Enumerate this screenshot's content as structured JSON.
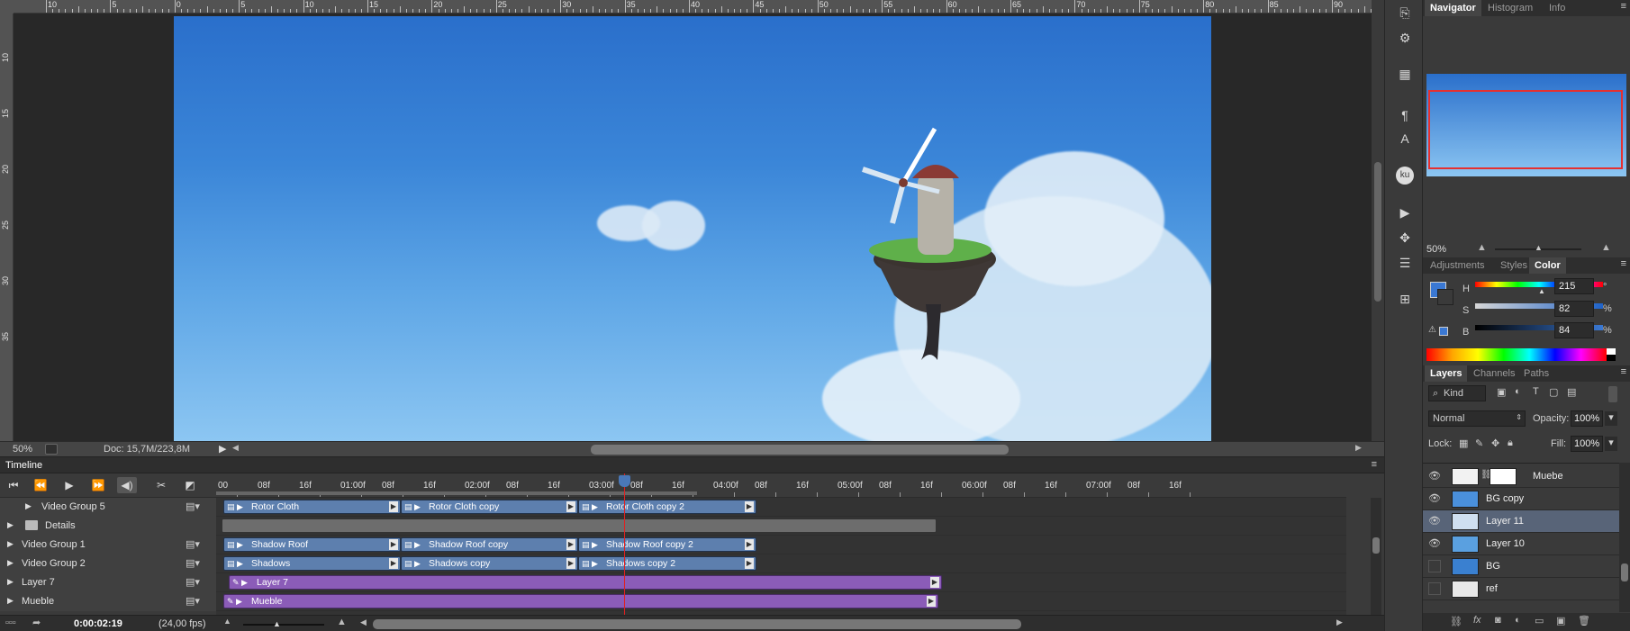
{
  "ruler": {
    "top_labels": [
      "10",
      "5",
      "0",
      "5",
      "10",
      "15",
      "20",
      "25",
      "30",
      "35",
      "40",
      "45",
      "50",
      "55",
      "60",
      "65",
      "70",
      "75",
      "80",
      "85",
      "90"
    ],
    "left_labels": [
      "10",
      "15",
      "20",
      "25",
      "30",
      "35"
    ]
  },
  "status": {
    "zoom": "50%",
    "doc": "Doc: 15,7M/223,8M"
  },
  "timeline": {
    "title": "Timeline",
    "timecode": "0:00:02:19",
    "fps": "(24,00 fps)",
    "ruler_labels": [
      "00",
      "08f",
      "16f",
      "01:00f",
      "08f",
      "16f",
      "02:00f",
      "08f",
      "16f",
      "03:00f",
      "08f",
      "16f",
      "04:00f",
      "08f",
      "16f",
      "05:00f",
      "08f",
      "16f",
      "06:00f",
      "08f",
      "16f",
      "07:00f",
      "08f",
      "16f"
    ],
    "tracks": [
      {
        "name": "Video Group 5",
        "clips": [
          "Rotor Cloth",
          "Rotor Cloth copy",
          "Rotor Cloth copy 2"
        ]
      },
      {
        "name": "Details",
        "clips": []
      },
      {
        "name": "Video Group 1",
        "clips": [
          "Shadow Roof",
          "Shadow Roof copy",
          "Shadow Roof copy 2"
        ]
      },
      {
        "name": "Video Group 2",
        "clips": [
          "Shadows",
          "Shadows copy",
          "Shadows copy 2"
        ]
      },
      {
        "name": "Layer 7",
        "clips": [
          "Layer 7"
        ]
      },
      {
        "name": "Mueble",
        "clips": [
          "Mueble"
        ]
      }
    ]
  },
  "navigator": {
    "tabs": [
      "Navigator",
      "Histogram",
      "Info"
    ],
    "zoom": "50%"
  },
  "color": {
    "tabs": [
      "Adjustments",
      "Styles",
      "Color"
    ],
    "h_label": "H",
    "h_value": "215",
    "h_unit": "°",
    "s_label": "S",
    "s_value": "82",
    "s_unit": "%",
    "b_label": "B",
    "b_value": "84",
    "b_unit": "%",
    "foreground": "#3a78d3",
    "background": "#ffffff"
  },
  "layers": {
    "tabs": [
      "Layers",
      "Channels",
      "Paths"
    ],
    "filter": "Kind",
    "blend_mode": "Normal",
    "opacity_label": "Opacity:",
    "opacity": "100%",
    "lock_label": "Lock:",
    "fill_label": "Fill:",
    "fill": "100%",
    "items": [
      {
        "name": "Muebe"
      },
      {
        "name": "BG copy"
      },
      {
        "name": "Layer 11"
      },
      {
        "name": "Layer 10"
      },
      {
        "name": "BG"
      },
      {
        "name": "ref"
      }
    ]
  }
}
